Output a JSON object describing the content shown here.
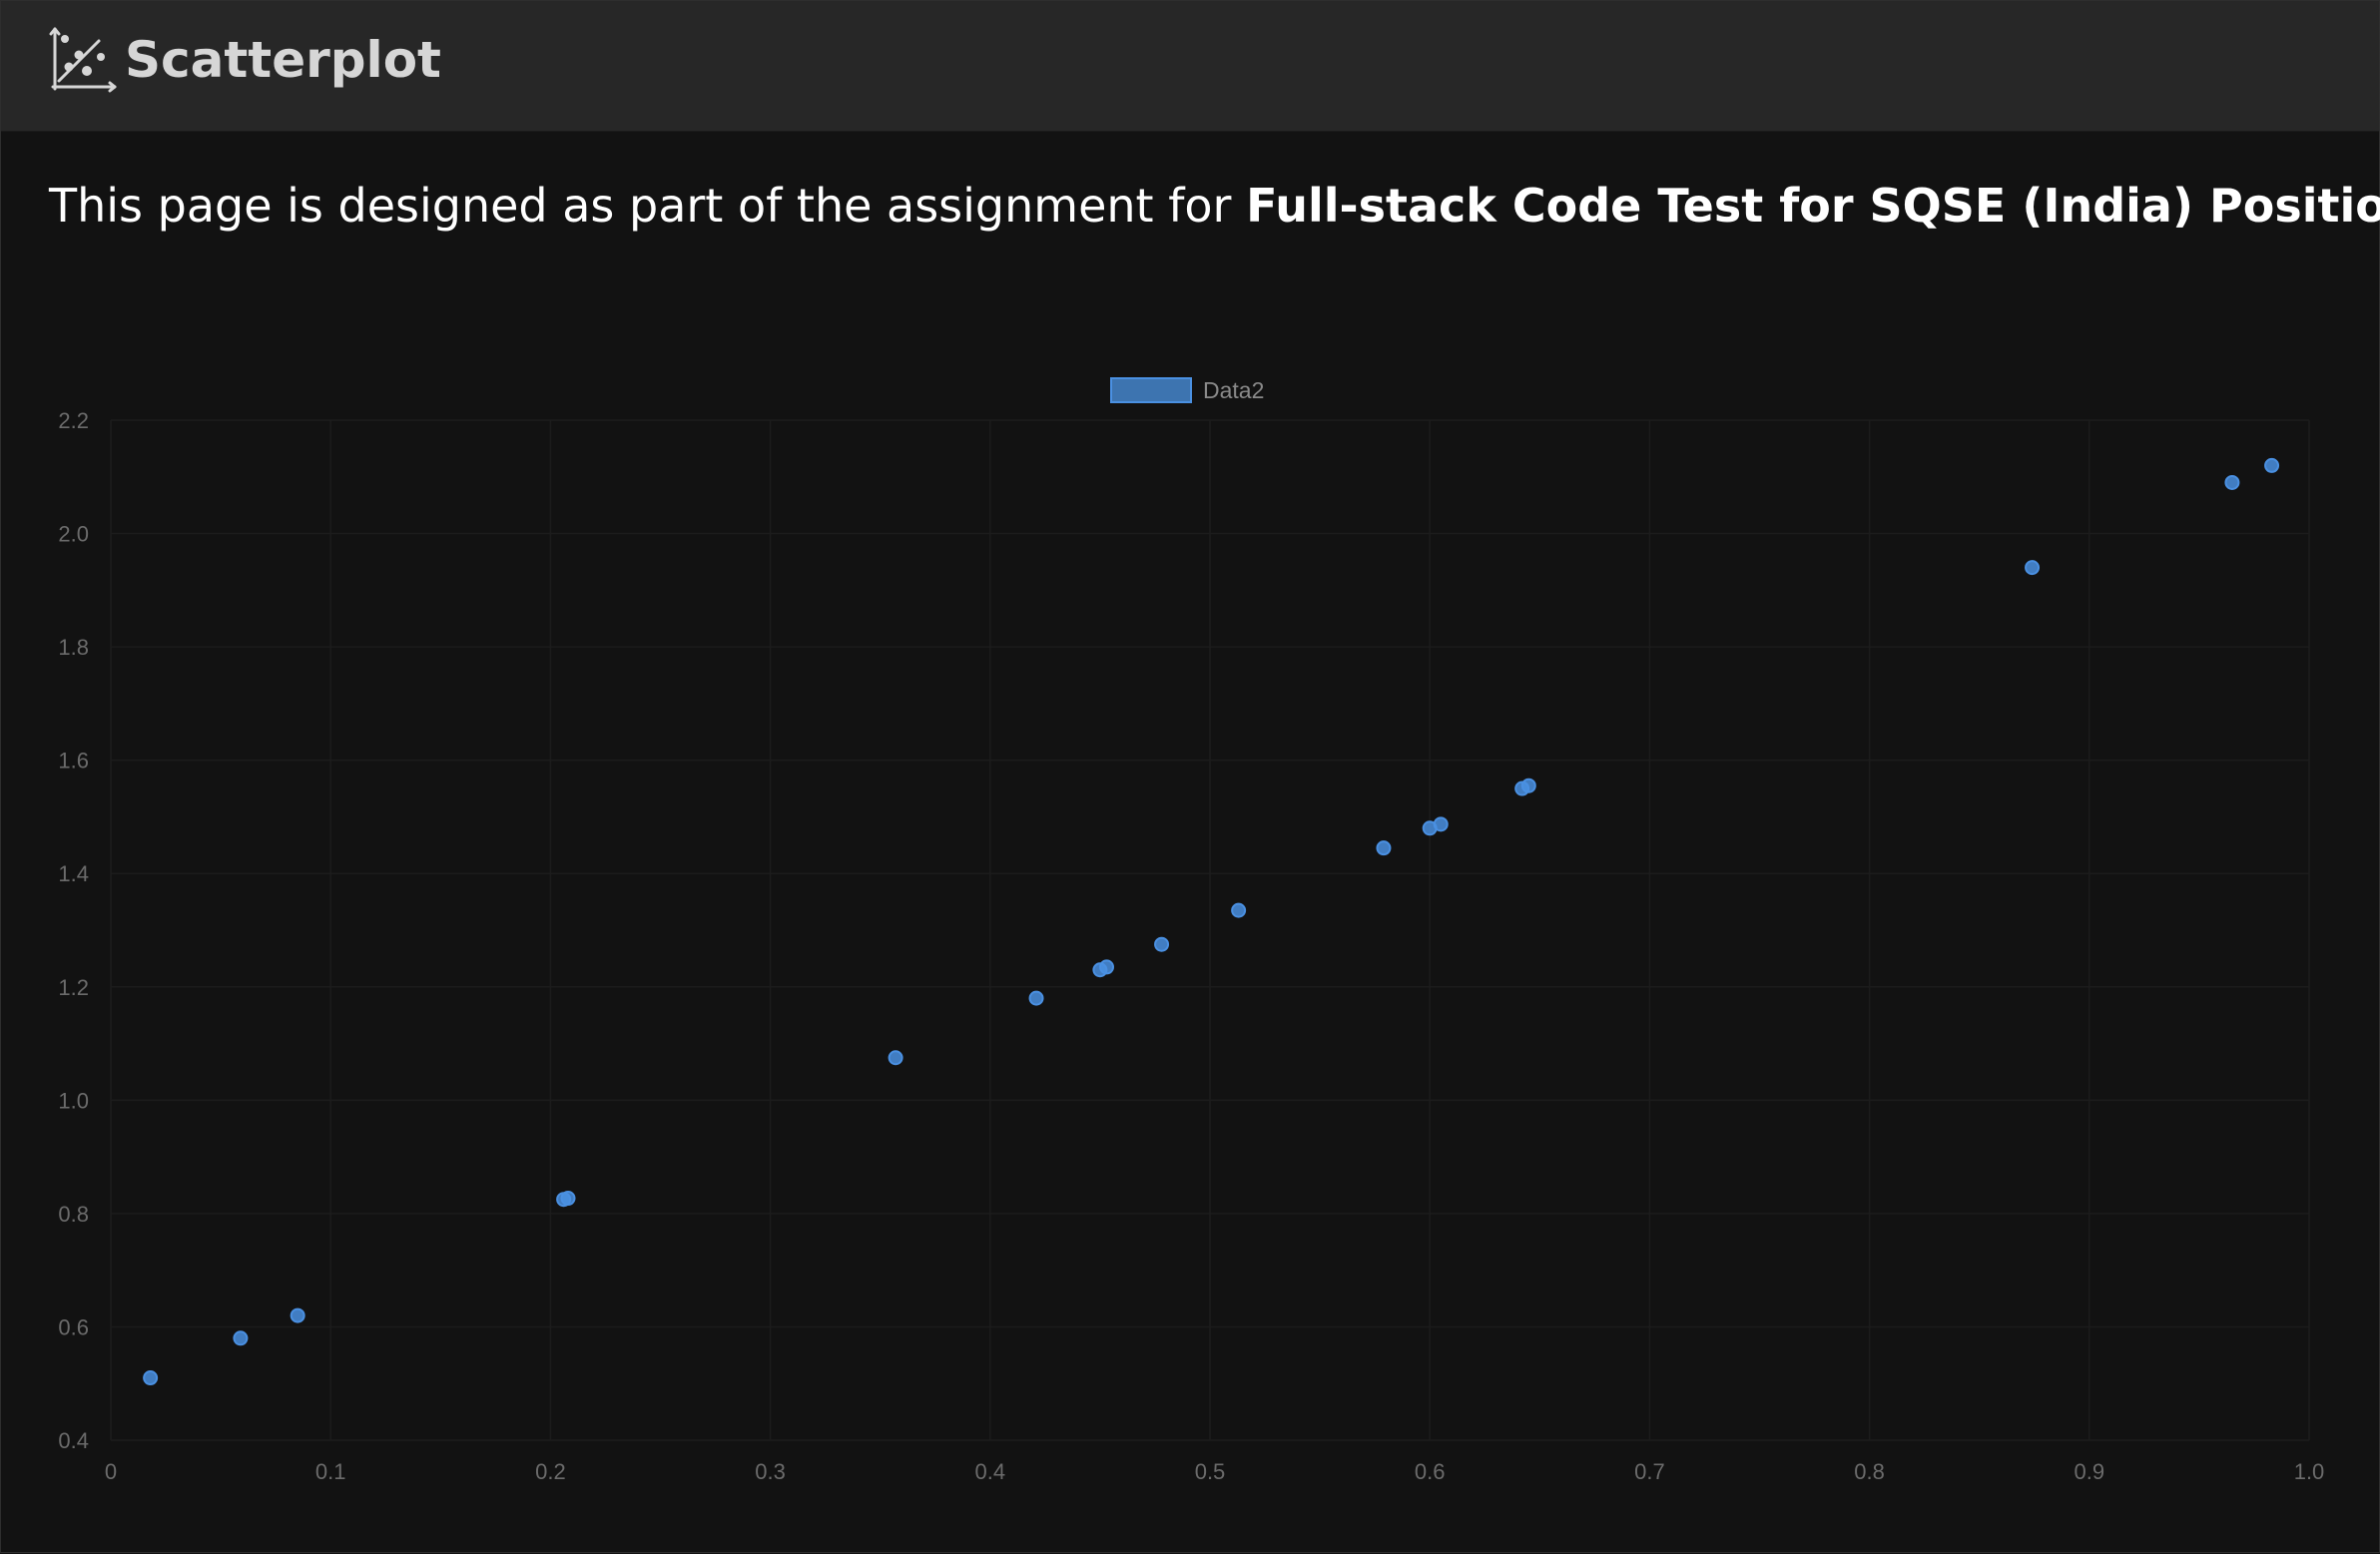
{
  "app": {
    "brand": "Scatterplot",
    "brand_icon": "scatterplot-icon"
  },
  "intro": {
    "text": "This page is designed as part of the assignment for ",
    "emphasis": "Full-stack Code Test for SQSE (India) Position"
  },
  "colors": {
    "background": "#121212",
    "topbar": "#272727",
    "point": "#4a90e2",
    "grid": "#1c1c1c",
    "tick_text": "#6b6b6b"
  },
  "chart_data": {
    "type": "scatter",
    "title": "",
    "xlabel": "",
    "ylabel": "",
    "xlim": [
      0,
      1.0
    ],
    "ylim": [
      0.4,
      2.2
    ],
    "x_ticks": [
      "0",
      "0.1",
      "0.2",
      "0.3",
      "0.4",
      "0.5",
      "0.6",
      "0.7",
      "0.8",
      "0.9",
      "1.0"
    ],
    "y_ticks": [
      "0.4",
      "0.6",
      "0.8",
      "1.0",
      "1.2",
      "1.4",
      "1.6",
      "1.8",
      "2.0",
      "2.2"
    ],
    "grid": true,
    "legend_position": "top-center",
    "series": [
      {
        "name": "Data2",
        "color": "#4a90e2",
        "points": [
          [
            0.018,
            0.51
          ],
          [
            0.059,
            0.58
          ],
          [
            0.085,
            0.62
          ],
          [
            0.206,
            0.825
          ],
          [
            0.208,
            0.827
          ],
          [
            0.357,
            1.075
          ],
          [
            0.421,
            1.18
          ],
          [
            0.45,
            1.23
          ],
          [
            0.453,
            1.235
          ],
          [
            0.478,
            1.275
          ],
          [
            0.513,
            1.335
          ],
          [
            0.579,
            1.445
          ],
          [
            0.6,
            1.48
          ],
          [
            0.605,
            1.487
          ],
          [
            0.642,
            1.55
          ],
          [
            0.645,
            1.555
          ],
          [
            0.874,
            1.94
          ],
          [
            0.965,
            2.09
          ],
          [
            0.983,
            2.12
          ]
        ]
      }
    ]
  }
}
